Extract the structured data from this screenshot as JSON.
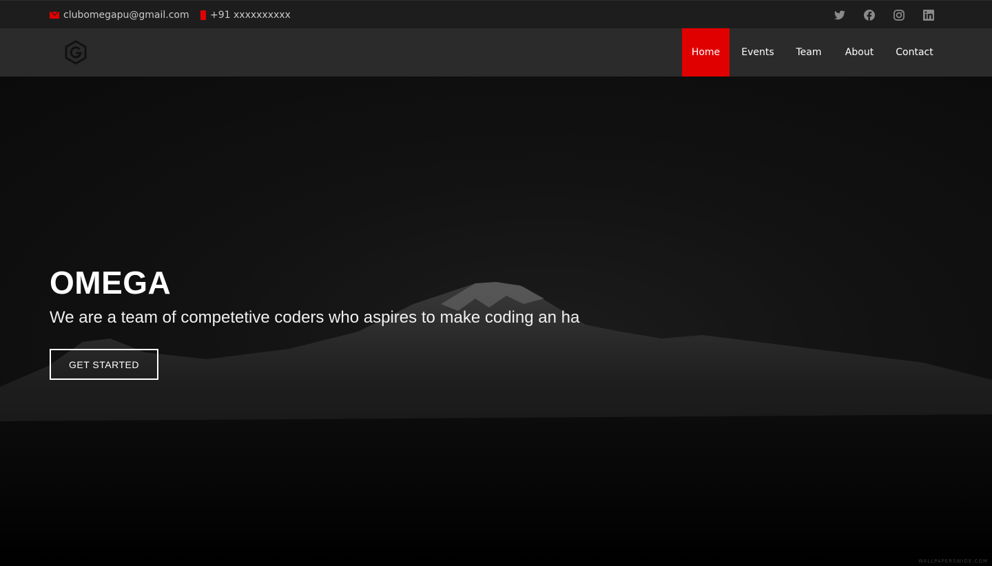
{
  "topbar": {
    "email": "clubomegapu@gmail.com",
    "phone": "+91 xxxxxxxxxx",
    "social": [
      "twitter-icon",
      "facebook-icon",
      "instagram-icon",
      "linkedin-icon"
    ]
  },
  "nav": {
    "items": [
      {
        "label": "Home",
        "active": true
      },
      {
        "label": "Events"
      },
      {
        "label": "Team"
      },
      {
        "label": "About"
      },
      {
        "label": "Contact"
      }
    ]
  },
  "hero": {
    "title": "OMEGA",
    "subtitle": "We are a team of competetive coders who aspires to make coding an ha",
    "cta": "GET STARTED"
  },
  "watermark": "WALLPAPERSWIDE.COM",
  "colors": {
    "accent": "#e00000",
    "topbar_bg": "#1d1d1d",
    "navbar_bg": "#2b2b2b"
  }
}
